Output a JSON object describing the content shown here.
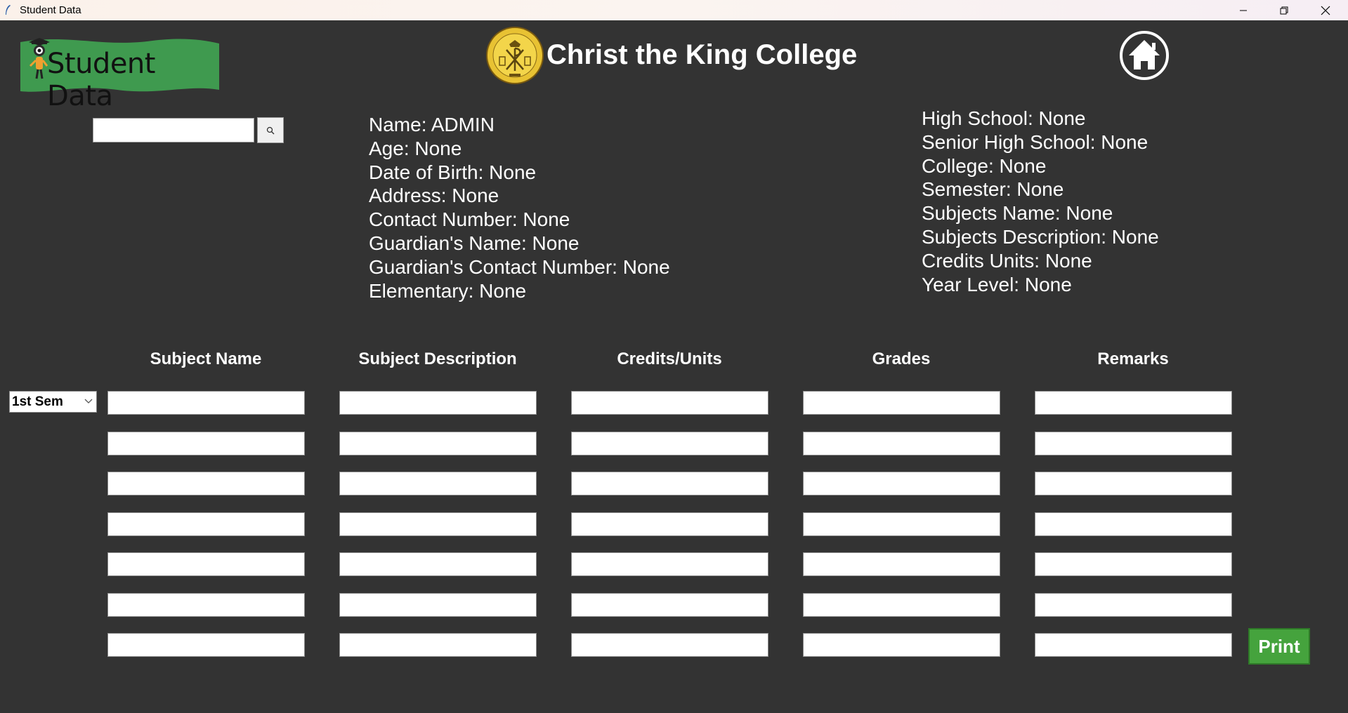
{
  "window": {
    "title": "Student Data",
    "minimize_icon": "minimize-icon",
    "maximize_icon": "restore-icon",
    "close_icon": "close-icon"
  },
  "header": {
    "logo_text": "Student Data",
    "college_name": "Christ the King College",
    "seal_icon": "college-seal-icon",
    "home_icon": "home-icon"
  },
  "search": {
    "value": "",
    "icon": "search-icon"
  },
  "student_info": {
    "left": [
      "Name: ADMIN",
      "Age: None",
      "Date of Birth: None",
      "Address: None",
      "Contact Number: None",
      "Guardian's Name: None",
      "Guardian's Contact Number: None",
      "Elementary: None"
    ],
    "right": [
      "High School: None",
      "Senior High School: None",
      "College: None",
      "Semester: None",
      "Subjects Name: None",
      "Subjects Description: None",
      "Credits Units: None",
      "Year Level: None"
    ]
  },
  "grades_table": {
    "columns": [
      "Subject Name",
      "Subject Description",
      "Credits/Units",
      "Grades",
      "Remarks"
    ],
    "row_count": 7,
    "semester": "1st Sem"
  },
  "actions": {
    "print_label": "Print"
  },
  "colors": {
    "background": "#333333",
    "logo_banner": "#3f9a4f",
    "print_button": "#45a33d",
    "seal_gold": "#e8c233"
  }
}
